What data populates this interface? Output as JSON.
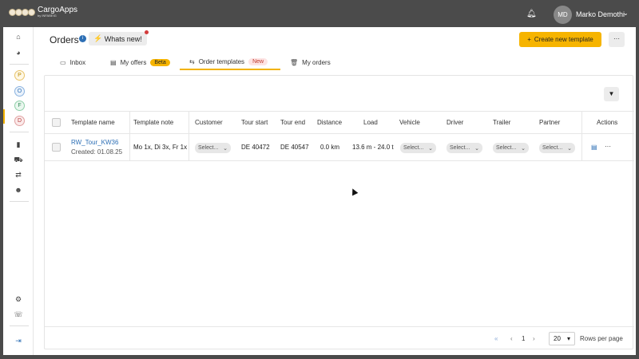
{
  "topbar": {
    "app_name": "CargoApps",
    "app_sub": "by INFABEIG",
    "bell_icon": "bell-icon",
    "avatar_initials": "MD",
    "user_name": "Marko Demothi",
    "user_chevron": "⌄"
  },
  "sidebar": {
    "letters": [
      "P",
      "O",
      "F",
      "D"
    ]
  },
  "header": {
    "title": "Orders",
    "info_glyph": "i",
    "whats_new": "Whats new!",
    "whats_new_glyph": "⚡",
    "create_label": "Create new template",
    "create_glyph": "+",
    "more_glyph": "···"
  },
  "tabs": [
    {
      "label": "Inbox",
      "icon": "laptop-icon",
      "badge": ""
    },
    {
      "label": "My offers",
      "icon": "document-icon",
      "badge": "Beta"
    },
    {
      "label": "Order templates",
      "icon": "repeat-icon",
      "badge": "New"
    },
    {
      "label": "My orders",
      "icon": "trash-icon",
      "badge": ""
    }
  ],
  "table": {
    "columns": [
      "Template name",
      "Template note",
      "Customer",
      "Tour start",
      "Tour end",
      "Distance",
      "Load",
      "Vehicle",
      "Driver",
      "Trailer",
      "Partner",
      "Actions"
    ],
    "rows": [
      {
        "template_name": "RW_Tour_KW36",
        "created": "Created: 01.08.25",
        "note": "Mo 1x, Di 3x, Fr 1x",
        "customer": "Select...",
        "tour_start": "DE 40472",
        "tour_end": "DE 40547",
        "distance": "0.0 km",
        "load": "13.6 m - 24.0 t",
        "vehicle": "Select...",
        "driver": "Select...",
        "trailer": "Select...",
        "partner": "Select..."
      }
    ]
  },
  "footer": {
    "first": "«",
    "prev": "‹",
    "page": "1",
    "next": "›",
    "rows_value": "20",
    "rows_label": "Rows per page"
  }
}
